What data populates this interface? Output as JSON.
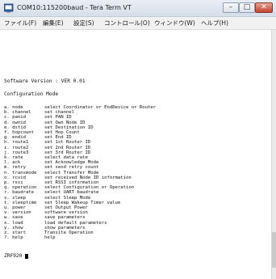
{
  "window": {
    "title": "COM10:115200baud - Tera Term VT",
    "buttons": {
      "minimize": "–",
      "maximize": "□",
      "close": "✕"
    }
  },
  "menu": {
    "items": [
      "ファイル(F)",
      "編集(E)",
      "設定(S)",
      "コントロール(O)",
      "ウィンドウ(W)",
      "ヘルプ(H)"
    ]
  },
  "terminal": {
    "version_line": "Software Version : VER 0.01",
    "config_header": "Configuration Mode",
    "commands": [
      {
        "name": "a. node",
        "desc": "select Coordinator or EndDevice or Router"
      },
      {
        "name": "b. channel",
        "desc": "set channel"
      },
      {
        "name": "c. panid",
        "desc": "set PAN ID"
      },
      {
        "name": "d. ownid",
        "desc": "set Own Node ID"
      },
      {
        "name": "e. dstid",
        "desc": "set Destination ID"
      },
      {
        "name": "f. hopcount",
        "desc": "set Hop Count"
      },
      {
        "name": "g. endid",
        "desc": "set End ID"
      },
      {
        "name": "h. route1",
        "desc": "set 1st Router ID"
      },
      {
        "name": "i. route2",
        "desc": "set 2nd Router ID"
      },
      {
        "name": "j. route3",
        "desc": "set 3rd Router ID"
      },
      {
        "name": "k. rate",
        "desc": "select data rate"
      },
      {
        "name": "l. ack",
        "desc": "set Acknowledge Mode"
      },
      {
        "name": "m. retry",
        "desc": "set send retry count"
      },
      {
        "name": "n. transmode",
        "desc": "select Transfer Mode"
      },
      {
        "name": "o. rcvid",
        "desc": "set received Node ID information"
      },
      {
        "name": "p. rssi",
        "desc": "set RSSI information"
      },
      {
        "name": "q. operation",
        "desc": "select Configuration or Operation"
      },
      {
        "name": "r. baudrate",
        "desc": "select UART baudrate"
      },
      {
        "name": "s. sleep",
        "desc": "select Sleep Mode"
      },
      {
        "name": "t. sleeptime",
        "desc": "set Sleep Wakeup Timer value"
      },
      {
        "name": "u. power",
        "desc": "set Output Power"
      },
      {
        "name": "v. version",
        "desc": "software version"
      },
      {
        "name": "w. save",
        "desc": "save parameters"
      },
      {
        "name": "x. load",
        "desc": "load default parameters"
      },
      {
        "name": "y. show",
        "desc": "show parameters"
      },
      {
        "name": "z. start",
        "desc": "Transite Operation"
      },
      {
        "name": "?. help",
        "desc": "help"
      }
    ],
    "prompt": "ZRF920 >"
  }
}
